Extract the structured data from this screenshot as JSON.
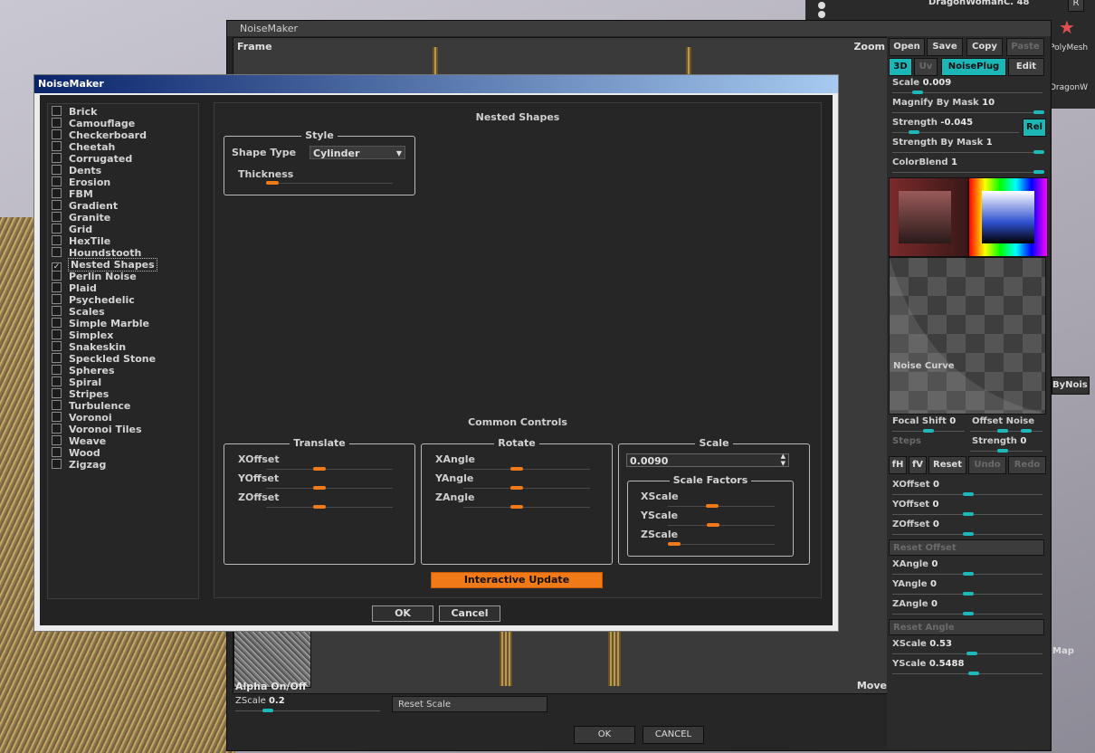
{
  "background": {
    "top_right_label": "DragonWomanC. 48",
    "top_right_btn": "R",
    "polymesh_label": "PolyMesh",
    "dragon_label": "DragonW",
    "bynoise_label": "ByNois",
    "map_label": "Map"
  },
  "back_window": {
    "title": "NoiseMaker",
    "frame_label": "Frame",
    "zoom_label": "Zoom",
    "move_label": "Move",
    "alpha_label": "Alpha On/Off",
    "zscale_label": "ZScale",
    "zscale_value": "0.2",
    "reset_scale": "Reset Scale",
    "ok": "OK",
    "cancel": "CANCEL"
  },
  "right_panel": {
    "open": "Open",
    "save": "Save",
    "copy": "Copy",
    "paste": "Paste",
    "mode_3d": "3D",
    "mode_uv": "Uv",
    "noiseplug": "NoisePlug",
    "edit": "Edit",
    "scale_label": "Scale",
    "scale_value": "0.009",
    "magnify_label": "Magnify By Mask",
    "magnify_value": "10",
    "strength_label": "Strength",
    "strength_value": "-0.045",
    "rel": "Rel",
    "strength_mask_label": "Strength By Mask",
    "strength_mask_value": "1",
    "colorblend_label": "ColorBlend",
    "colorblend_value": "1",
    "curve_label": "Noise Curve",
    "focal_label": "Focal Shift",
    "focal_value": "0",
    "offset_noise": "Offset Noise",
    "steps_label": "Steps",
    "strength2_label": "Strength",
    "strength2_value": "0",
    "fh": "fH",
    "fv": "fV",
    "reset": "Reset",
    "undo": "Undo",
    "redo": "Redo",
    "xoffset_label": "XOffset",
    "xoffset_value": "0",
    "yoffset_label": "YOffset",
    "yoffset_value": "0",
    "zoffset_label": "ZOffset",
    "zoffset_value": "0",
    "reset_offset": "Reset Offset",
    "xangle_label": "XAngle",
    "xangle_value": "0",
    "yangle_label": "YAngle",
    "yangle_value": "0",
    "zangle_label": "ZAngle",
    "zangle_value": "0",
    "reset_angle": "Reset Angle",
    "xscale_label": "XScale",
    "xscale_value": "0.53",
    "yscale_label": "YScale",
    "yscale_value": "0.5488"
  },
  "dialog": {
    "title": "NoiseMaker",
    "noise_list": [
      {
        "label": "Brick",
        "checked": false
      },
      {
        "label": "Camouflage",
        "checked": false
      },
      {
        "label": "Checkerboard",
        "checked": false
      },
      {
        "label": "Cheetah",
        "checked": false
      },
      {
        "label": "Corrugated",
        "checked": false
      },
      {
        "label": "Dents",
        "checked": false
      },
      {
        "label": "Erosion",
        "checked": false
      },
      {
        "label": "FBM",
        "checked": false
      },
      {
        "label": "Gradient",
        "checked": false
      },
      {
        "label": "Granite",
        "checked": false
      },
      {
        "label": "Grid",
        "checked": false
      },
      {
        "label": "HexTile",
        "checked": false
      },
      {
        "label": "Houndstooth",
        "checked": false
      },
      {
        "label": "Nested Shapes",
        "checked": true
      },
      {
        "label": "Perlin Noise",
        "checked": false
      },
      {
        "label": "Plaid",
        "checked": false
      },
      {
        "label": "Psychedelic",
        "checked": false
      },
      {
        "label": "Scales",
        "checked": false
      },
      {
        "label": "Simple Marble",
        "checked": false
      },
      {
        "label": "Simplex",
        "checked": false
      },
      {
        "label": "Snakeskin",
        "checked": false
      },
      {
        "label": "Speckled Stone",
        "checked": false
      },
      {
        "label": "Spheres",
        "checked": false
      },
      {
        "label": "Spiral",
        "checked": false
      },
      {
        "label": "Stripes",
        "checked": false
      },
      {
        "label": "Turbulence",
        "checked": false
      },
      {
        "label": "Voronoi",
        "checked": false
      },
      {
        "label": "Voronoi Tiles",
        "checked": false
      },
      {
        "label": "Weave",
        "checked": false
      },
      {
        "label": "Wood",
        "checked": false
      },
      {
        "label": "Zigzag",
        "checked": false
      }
    ],
    "section_title": "Nested Shapes",
    "style": {
      "title": "Style",
      "shape_type_label": "Shape Type",
      "shape_type_value": "Cylinder",
      "thickness_label": "Thickness"
    },
    "common_title": "Common Controls",
    "translate": {
      "title": "Translate",
      "x": "XOffset",
      "y": "YOffset",
      "z": "ZOffset"
    },
    "rotate": {
      "title": "Rotate",
      "x": "XAngle",
      "y": "YAngle",
      "z": "ZAngle"
    },
    "scale": {
      "title": "Scale",
      "value": "0.0090",
      "factors_title": "Scale Factors",
      "x": "XScale",
      "y": "YScale",
      "z": "ZScale"
    },
    "interactive_update": "Interactive Update",
    "ok": "OK",
    "cancel": "Cancel"
  }
}
